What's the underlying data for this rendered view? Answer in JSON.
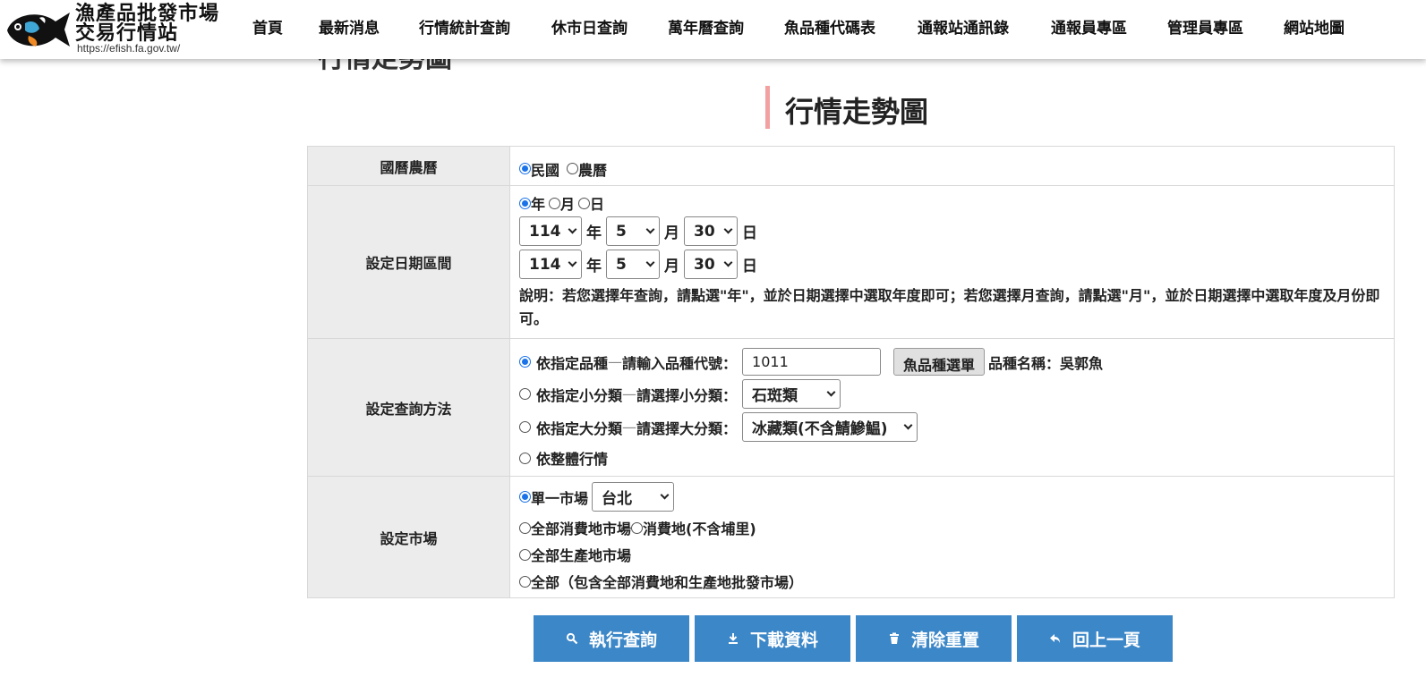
{
  "site": {
    "logo_line1": "漁產品批發市場",
    "logo_line2": "交易行情站",
    "logo_url": "https://efish.fa.gov.tw/"
  },
  "nav": [
    "首頁",
    "最新消息",
    "行情統計查詢",
    "休市日查詢",
    "萬年曆查詢",
    "魚品種代碼表",
    "通報站通訊錄",
    "通報員專區",
    "管理員專區",
    "網站地圖"
  ],
  "page": {
    "behind_title": "行情走勢圖",
    "title": "行情走勢圖"
  },
  "calendar": {
    "label": "國曆農曆",
    "opt_roc": "民國",
    "opt_lunar": "農曆"
  },
  "date_range": {
    "label": "設定日期區間",
    "opt_year": "年",
    "opt_month": "月",
    "opt_day": "日",
    "start": {
      "year": "114",
      "month": "5",
      "day": "30"
    },
    "end": {
      "year": "114",
      "month": "5",
      "day": "30"
    },
    "unit_year": "年",
    "unit_month": "月",
    "unit_day": "日",
    "note": "說明：若您選擇年查詢，請點選\"年\"，並於日期選擇中選取年度即可；若您選擇月查詢，請點選\"月\"，並於日期選擇中選取年度及月份即可。"
  },
  "method": {
    "label": "設定查詢方法",
    "opt_species": "依指定品種",
    "dash": "—",
    "species_prompt": "請輸入品種代號：",
    "species_code": "1011",
    "species_menu_btn": "魚品種選單",
    "species_name": "品種名稱：吳郭魚",
    "opt_subcat": "依指定小分類",
    "subcat_prompt": "請選擇小分類：",
    "subcat_value": "石斑類",
    "opt_maincat": "依指定大分類",
    "maincat_prompt": "請選擇大分類：",
    "maincat_value": "冰藏類(不含鯖鰺鰛)",
    "opt_overall": "依整體行情"
  },
  "market": {
    "label": "設定市場",
    "opt_single": "單一市場",
    "single_value": "台北",
    "opt_all_consumer": "全部消費地市場",
    "opt_consumer_excl": "消費地(不含埔里)",
    "opt_all_producer": "全部生產地市場",
    "opt_all": "全部（包含全部消費地和生產地批發市場）"
  },
  "buttons": {
    "query": "執行查詢",
    "download": "下載資料",
    "reset": "清除重置",
    "back": "回上一頁"
  },
  "colors": {
    "accent_blue": "#3c87c8",
    "title_bar": "#f2a0a0",
    "label_bg": "#ececec"
  }
}
